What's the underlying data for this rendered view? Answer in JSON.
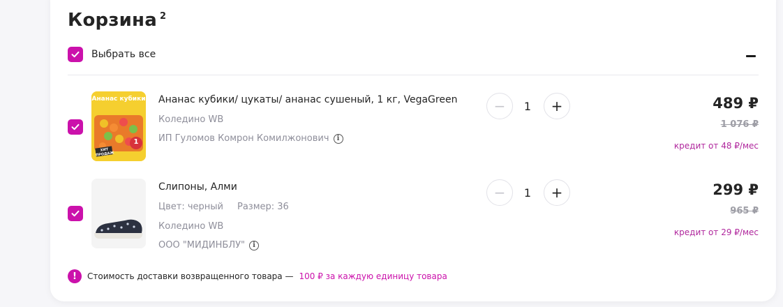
{
  "cart": {
    "title": "Корзина",
    "count": "2",
    "select_all_label": "Выбрать все"
  },
  "items": [
    {
      "name": "Ананас кубики/ цукаты/ ананас сушеный, 1 кг, VegaGreen",
      "warehouse": "Коледино WB",
      "seller": "ИП Гуломов Комрон Комилжонович",
      "quantity": "1",
      "price": "489 ₽",
      "old_price": "1 076 ₽",
      "credit": "кредит от 48 ₽/мес",
      "image": {
        "title_text": "Ананас кубики",
        "badge_text": "ХИТ ПРОДАЖ",
        "number_text": "1"
      }
    },
    {
      "name": "Слипоны, Алми",
      "color": "Цвет: черный",
      "size": "Размер: 36",
      "warehouse": "Коледино WB",
      "seller": "ООО \"МИДИНБЛУ\"",
      "quantity": "1",
      "price": "299 ₽",
      "old_price": "965 ₽",
      "credit": "кредит от 29 ₽/мес"
    }
  ],
  "qty_controls": {
    "minus": "−",
    "plus": "+"
  },
  "notice": {
    "text": "Стоимость доставки возвращенного товара —",
    "accent": "100 ₽ за каждую единицу товара"
  },
  "colors": {
    "accent": "#cb11ab",
    "background": "#f6f6f9",
    "card": "#ffffff"
  },
  "icons": [
    "check-icon",
    "minus-icon",
    "info-icon",
    "exclamation-icon"
  ]
}
